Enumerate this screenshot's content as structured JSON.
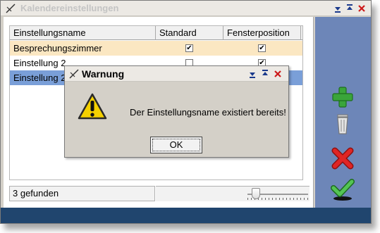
{
  "window": {
    "title": "Kalendereinstellungen"
  },
  "table": {
    "columns": [
      "Einstellungsname",
      "Standard",
      "Fensterposition"
    ],
    "rows": [
      {
        "name": "Besprechungszimmer",
        "standard": true,
        "fensterposition": true,
        "state": "highlighted"
      },
      {
        "name": "Einstellung 2",
        "standard": false,
        "fensterposition": true,
        "state": "normal"
      },
      {
        "name": "Einstellung 2",
        "standard": false,
        "fensterposition": false,
        "state": "selected"
      }
    ]
  },
  "status": {
    "count_text": "3 gefunden"
  },
  "side_buttons": [
    "add-icon",
    "trash-icon",
    "delete-icon",
    "confirm-icon"
  ],
  "dialog": {
    "title": "Warnung",
    "message": "Der Einstellungsname existiert bereits!",
    "ok_label": "OK"
  },
  "colors": {
    "highlight_row": "#fbe7c2",
    "selected_row": "#7a9fd8",
    "side_panel": "#6d86b8",
    "bottom_bar": "#20456e"
  }
}
